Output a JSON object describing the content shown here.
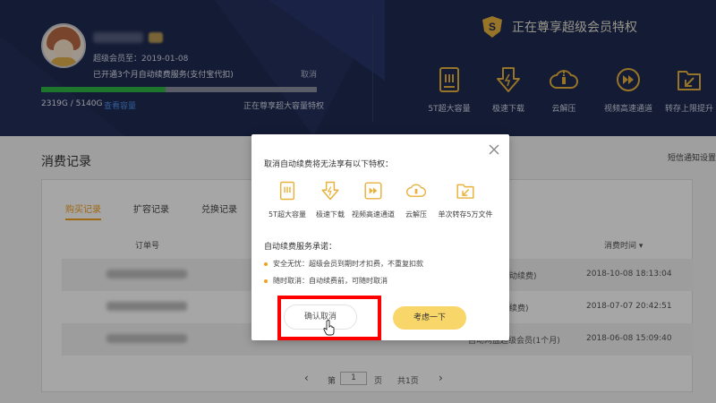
{
  "header": {
    "member_since": "超级会员至：2019-01-08",
    "auto_renew_status": "已开通3个月自动续费服务(支付宝代扣)",
    "cancel_link": "取消",
    "storage": "2319G / 5140G",
    "storage_used_fraction": 0.45,
    "expand_link": "查看容量",
    "enjoying_text": "正在尊享超大容量特权",
    "vip_title": "正在尊享超级会员特权",
    "perks": [
      {
        "icon": "storage-icon",
        "label": "5T超大容量"
      },
      {
        "icon": "download-icon",
        "label": "极速下载"
      },
      {
        "icon": "cloud-unzip-icon",
        "label": "云解压"
      },
      {
        "icon": "video-icon",
        "label": "视频高速通道"
      },
      {
        "icon": "transfer-icon",
        "label": "转存上限提升"
      }
    ]
  },
  "main": {
    "title": "消费记录",
    "sms_setting": "短信通知设置",
    "tabs": [
      "购买记录",
      "扩容记录",
      "兑换记录"
    ],
    "columns": {
      "order": "订单号",
      "time": "消费时间 ▾"
    },
    "rows": [
      {
        "item": "动续费)",
        "time": "2018-10-08 18:13:04"
      },
      {
        "item": "续费)",
        "time": "2018-07-07 20:42:51"
      },
      {
        "item": "自动网盘超级会员(1个月)",
        "time": "2018-06-08 15:09:40"
      }
    ],
    "pagination": {
      "prefix": "第",
      "current": "1",
      "suffix": "页",
      "total": "共1页",
      "prev": "‹",
      "next": "›"
    }
  },
  "modal": {
    "title": "取消自动续费将无法享有以下特权：",
    "perks": [
      {
        "icon": "storage-icon",
        "label": "5T超大容量"
      },
      {
        "icon": "download-icon",
        "label": "极速下载"
      },
      {
        "icon": "video-icon",
        "label": "视频高速通道"
      },
      {
        "icon": "cloud-unzip-icon",
        "label": "云解压"
      },
      {
        "icon": "transfer-icon",
        "label": "单次转存5万文件"
      }
    ],
    "promise_title": "自动续费服务承诺：",
    "promises": [
      "安全无忧：超级会员到期时才扣费，不重复扣款",
      "随时取消：自动续费前，可随时取消"
    ],
    "confirm_label": "确认取消",
    "consider_label": "考虑一下"
  },
  "colors": {
    "accent": "#f2a11d",
    "header_bg": "#1e2a52",
    "highlight": "#ff0000",
    "progress": "#2fb544"
  }
}
